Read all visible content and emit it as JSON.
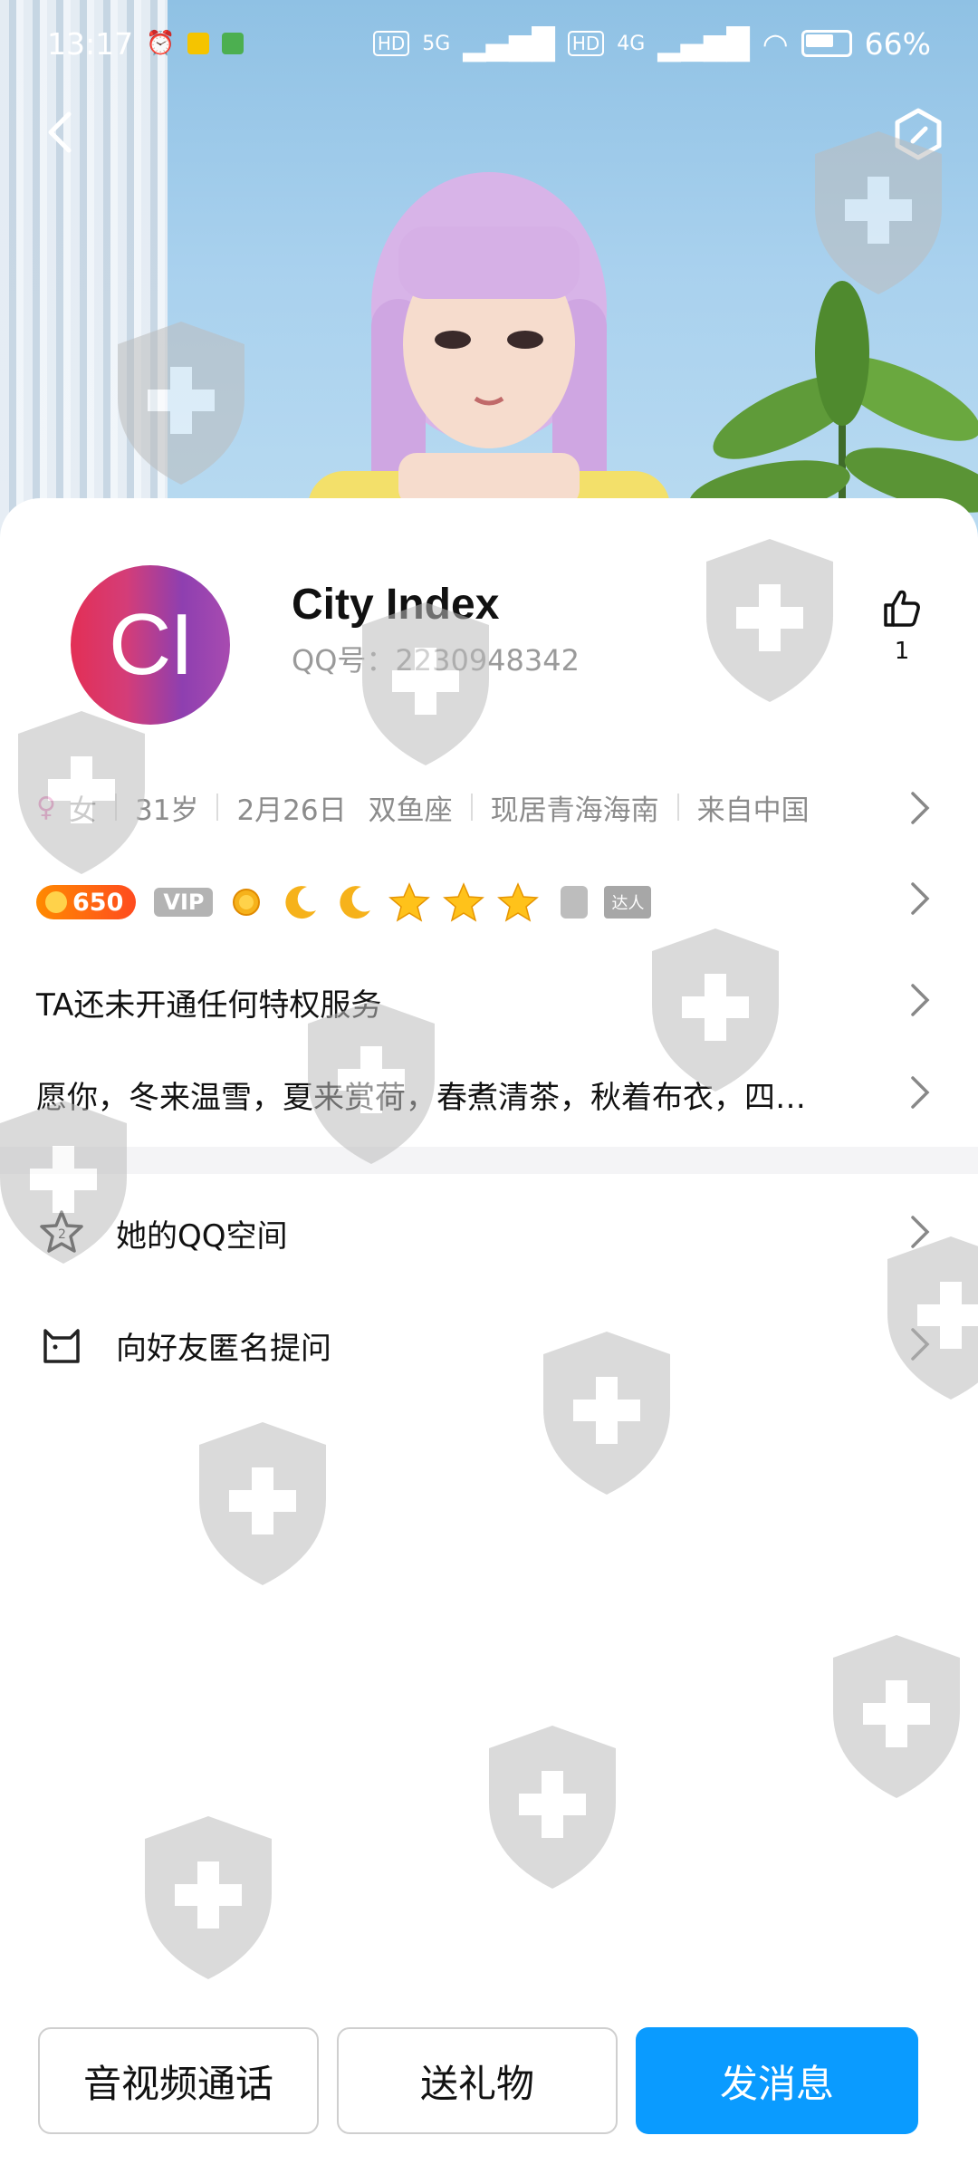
{
  "status_bar": {
    "time": "13:17",
    "network_1": "5G",
    "network_2": "4G",
    "battery": "66%"
  },
  "profile": {
    "logo_text": "CI",
    "name": "City Index",
    "qq_label": "QQ号：2230948342",
    "likes": "1",
    "gender": "女",
    "age": "31岁",
    "birthday": "2月26日",
    "zodiac": "双鱼座",
    "location": "现居青海海南",
    "origin": "来自中国",
    "coins": "650",
    "vip": "VIP",
    "daren": "达人",
    "privilege": "TA还未开通任何特权服务",
    "signature": "愿你，冬来温雪，夏来赏荷，春煮清茶，秋着布衣，四…"
  },
  "list": {
    "qzone": "她的QQ空间",
    "anonymous": "向好友匿名提问"
  },
  "buttons": {
    "call": "音视频通话",
    "gift": "送礼物",
    "message": "发消息"
  },
  "colors": {
    "primary": "#0a9bff",
    "coin": "#ff6a00"
  }
}
